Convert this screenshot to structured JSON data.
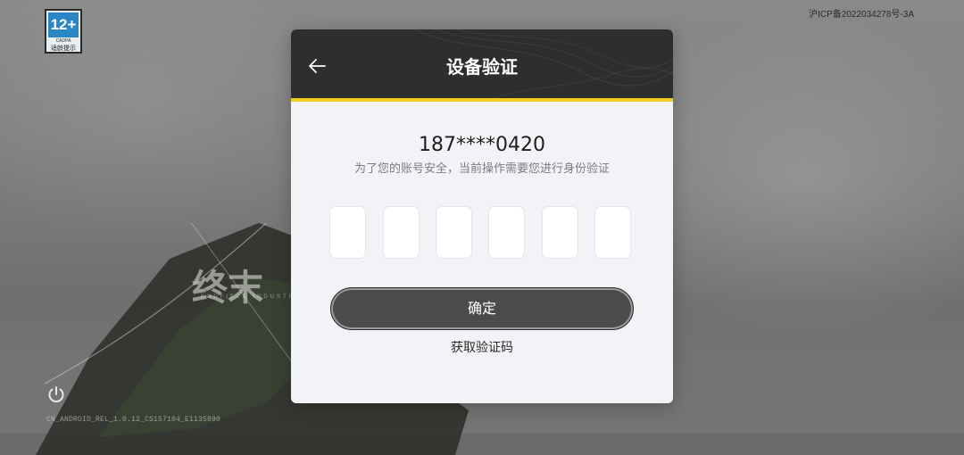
{
  "top_right": {
    "icp_text": "沪ICP备2022034278号-3A"
  },
  "age_badge": {
    "rating": "12+",
    "org": "CADPA",
    "note": "适龄提示"
  },
  "background": {
    "logo_text": "终末",
    "logo_sub": "ENDFIELD INDUSTRIES"
  },
  "footer": {
    "build_info": "CN_ANDROID_REL_1.0.12_CS157104_E1135890"
  },
  "dialog": {
    "title": "设备验证",
    "phone": "187****0420",
    "description": "为了您的账号安全，当前操作需要您进行身份验证",
    "code_digits": [
      "",
      "",
      "",
      "",
      "",
      ""
    ],
    "confirm_label": "确定",
    "get_code_label": "获取验证码"
  },
  "colors": {
    "accent": "#f1cf22",
    "header_bg": "#2e2e2e",
    "button_bg": "#4b4b4b"
  },
  "icons": {
    "back": "arrow-left-icon",
    "power": "power-icon"
  }
}
